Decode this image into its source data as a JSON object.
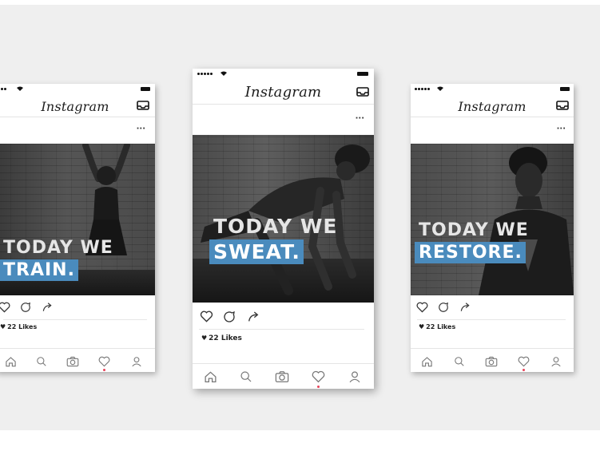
{
  "colors": {
    "accent_blue": "#4a8bbd",
    "notification_red": "#e8435a",
    "background": "#efefef"
  },
  "posts": [
    {
      "app_name": "Instagram",
      "more_label": "···",
      "headline_line1": "TODAY WE",
      "headline_line2": "TRAIN.",
      "likes": "22 Likes",
      "icons": [
        "heart-icon",
        "comment-icon",
        "share-icon",
        "home-icon",
        "search-icon",
        "camera-icon",
        "activity-heart-icon",
        "profile-icon"
      ]
    },
    {
      "app_name": "Instagram",
      "more_label": "···",
      "headline_line1": "TODAY WE",
      "headline_line2": "SWEAT.",
      "likes": "22 Likes",
      "icons": [
        "heart-icon",
        "comment-icon",
        "share-icon",
        "home-icon",
        "search-icon",
        "camera-icon",
        "activity-heart-icon",
        "profile-icon"
      ]
    },
    {
      "app_name": "Instagram",
      "more_label": "···",
      "headline_line1": "TODAY WE",
      "headline_line2": "RESTORE.",
      "likes": "22 Likes",
      "icons": [
        "heart-icon",
        "comment-icon",
        "share-icon",
        "home-icon",
        "search-icon",
        "camera-icon",
        "activity-heart-icon",
        "profile-icon"
      ]
    }
  ]
}
